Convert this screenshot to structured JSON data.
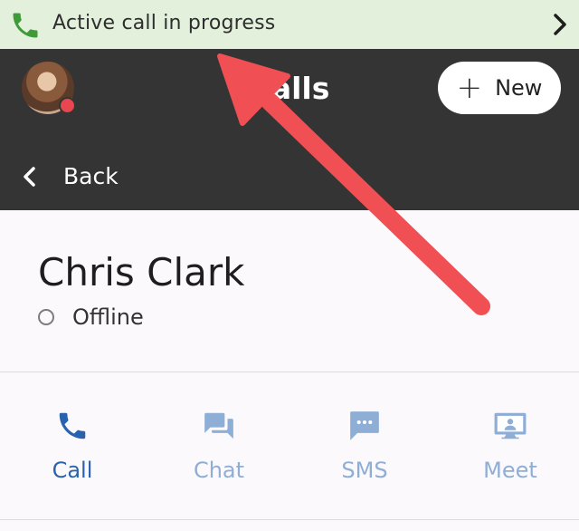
{
  "banner": {
    "text": "Active call in progress",
    "icon": "phone-icon",
    "chevron_icon": "chevron-right-icon",
    "color": "#e3f0dc"
  },
  "header": {
    "title": "Calls",
    "new_button_label": "New",
    "plus_icon": "+",
    "back_label": "Back",
    "presence_color": "#e8474f",
    "background": "#343434"
  },
  "contact": {
    "name": "Chris Clark",
    "status": "Offline"
  },
  "actions": [
    {
      "label": "Call",
      "icon": "phone-icon",
      "state": "active"
    },
    {
      "label": "Chat",
      "icon": "chat-bubbles-icon",
      "state": "inactive"
    },
    {
      "label": "SMS",
      "icon": "sms-icon",
      "state": "inactive"
    },
    {
      "label": "Meet",
      "icon": "meet-screen-icon",
      "state": "inactive"
    }
  ],
  "colors": {
    "accent": "#2a63ad",
    "accent_muted": "#8eaed6",
    "annotation_arrow": "#f04f54"
  }
}
